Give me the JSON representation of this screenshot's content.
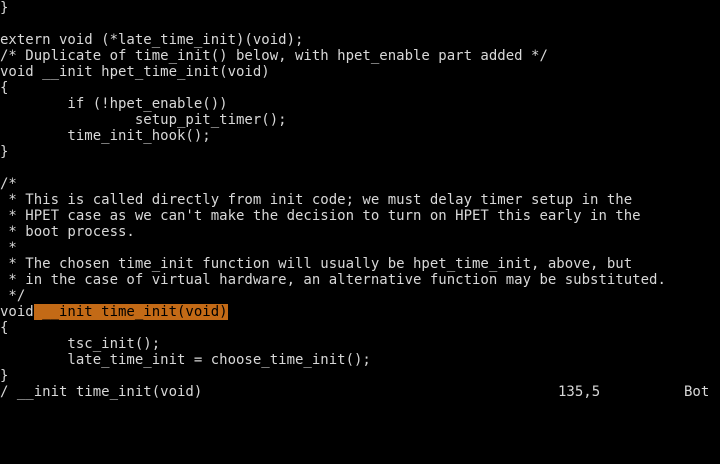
{
  "editor": {
    "lines": [
      {
        "segments": [
          {
            "text": "}",
            "highlight": false
          }
        ]
      },
      {
        "segments": [
          {
            "text": "",
            "highlight": false
          }
        ]
      },
      {
        "segments": [
          {
            "text": "extern void (*late_time_init)(void);",
            "highlight": false
          }
        ]
      },
      {
        "segments": [
          {
            "text": "/* Duplicate of time_init() below, with hpet_enable part added */",
            "highlight": false
          }
        ]
      },
      {
        "segments": [
          {
            "text": "void __init hpet_time_init(void)",
            "highlight": false
          }
        ]
      },
      {
        "segments": [
          {
            "text": "{",
            "highlight": false
          }
        ]
      },
      {
        "segments": [
          {
            "text": "        if (!hpet_enable())",
            "highlight": false
          }
        ]
      },
      {
        "segments": [
          {
            "text": "                setup_pit_timer();",
            "highlight": false
          }
        ]
      },
      {
        "segments": [
          {
            "text": "        time_init_hook();",
            "highlight": false
          }
        ]
      },
      {
        "segments": [
          {
            "text": "}",
            "highlight": false
          }
        ]
      },
      {
        "segments": [
          {
            "text": "",
            "highlight": false
          }
        ]
      },
      {
        "segments": [
          {
            "text": "/*",
            "highlight": false
          }
        ]
      },
      {
        "segments": [
          {
            "text": " * This is called directly from init code; we must delay timer setup in the",
            "highlight": false
          }
        ]
      },
      {
        "segments": [
          {
            "text": " * HPET case as we can't make the decision to turn on HPET this early in the",
            "highlight": false
          }
        ]
      },
      {
        "segments": [
          {
            "text": " * boot process.",
            "highlight": false
          }
        ]
      },
      {
        "segments": [
          {
            "text": " *",
            "highlight": false
          }
        ]
      },
      {
        "segments": [
          {
            "text": " * The chosen time_init function will usually be hpet_time_init, above, but",
            "highlight": false
          }
        ]
      },
      {
        "segments": [
          {
            "text": " * in the case of virtual hardware, an alternative function may be substituted.",
            "highlight": false
          }
        ]
      },
      {
        "segments": [
          {
            "text": " */",
            "highlight": false
          }
        ]
      },
      {
        "segments": [
          {
            "text": "void",
            "highlight": false
          },
          {
            "text": " __init time_init(void)",
            "highlight": true
          }
        ]
      },
      {
        "segments": [
          {
            "text": "{",
            "highlight": false
          }
        ]
      },
      {
        "segments": [
          {
            "text": "        tsc_init();",
            "highlight": false
          }
        ]
      },
      {
        "segments": [
          {
            "text": "        late_time_init = choose_time_init();",
            "highlight": false
          }
        ]
      },
      {
        "segments": [
          {
            "text": "}",
            "highlight": false
          }
        ]
      }
    ]
  },
  "statusbar": {
    "command": "/ __init time_init(void)",
    "position": "135,5",
    "scroll": "Bot"
  },
  "colors": {
    "background": "#000000",
    "text": "#d8d8d8",
    "search_highlight": "#c36a16"
  }
}
